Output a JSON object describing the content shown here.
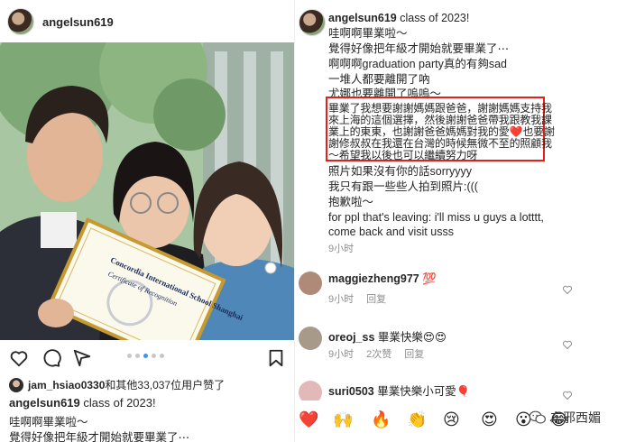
{
  "post": {
    "username": "angelsun619",
    "photo_certificate": [
      "Concordia International School Shanghai",
      "Certificate of Recognition"
    ],
    "carousel": {
      "count": 5,
      "active": 2
    },
    "likes_user": "jam_hsiao0330",
    "likes_text": "和其他33,037位用户赞了",
    "caption_user": "angelsun619",
    "caption_first": "class of 2023!",
    "caption_lines": [
      "哇啊啊畢業啦～",
      "覺得好像把年級才開始就要畢業了⋯"
    ]
  },
  "detail": {
    "username": "angelsun619",
    "caption_first": "class of 2023!",
    "caption_lines": [
      "哇啊啊畢業啦～",
      "覺得好像把年級才開始就要畢業了⋯",
      "啊啊啊graduation party真的有夠sad",
      "一堆人都要離開了吶",
      "尤娜也要離開了嗚嗚～"
    ],
    "highlighted_lines": [
      "畢業了我想要謝謝媽媽跟爸爸，謝謝媽媽支持我",
      "來上海的這個選擇，然後謝謝爸爸帶我跟教我課",
      "業上的東東，也謝謝爸爸媽媽對我的愛❤️也要謝",
      "謝修叔叔在我還在台灣的時候無微不至的照顧我",
      "～希望我以後也可以繼續努力呀"
    ],
    "after_lines": [
      "照片如果沒有你的話sorryyyy",
      "我只有跟一些些人拍到照片:(((",
      "抱歉啦～",
      "for ppl that's leaving: i'll miss u guys a lotttt,",
      "come back and visit usss"
    ],
    "post_time": "9小时"
  },
  "comments": [
    {
      "user": "maggiezheng977",
      "text": "💯",
      "time": "9小时",
      "likes": "",
      "reply": "回复",
      "avatar_color": "#b08a78"
    },
    {
      "user": "oreoj_ss",
      "text": "畢業快樂😍😍",
      "time": "9小时",
      "likes": "2次赞",
      "reply": "回复",
      "avatar_color": "#a89a88"
    },
    {
      "user": "suri0503",
      "text": "畢業快樂小可愛🎈",
      "time": "",
      "likes": "",
      "reply": "",
      "avatar_color": "#e3b8b8"
    }
  ],
  "emoji_bar": [
    "❤️",
    "🙌",
    "🔥",
    "👏",
    "😢",
    "😍",
    "😮",
    "😂"
  ],
  "watermark": "东邪西媚",
  "colors": {
    "highlight": "#e0211b",
    "carousel_active": "#3897f0",
    "muted": "#8e8e8e"
  }
}
